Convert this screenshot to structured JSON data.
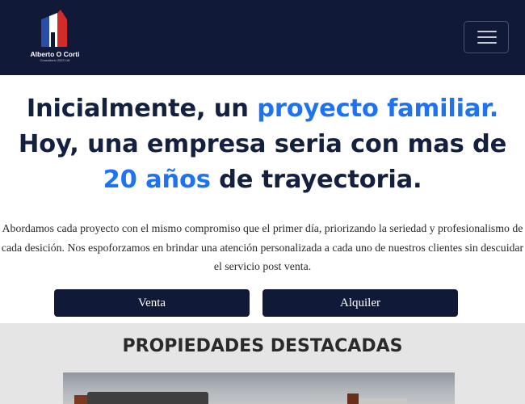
{
  "header": {
    "logo_name": "Alberto O Corti",
    "logo_subtitle": "Consultorio 2023 LW",
    "logo_colors": [
      "#2a4da8",
      "#ffffff",
      "#d52a2a"
    ],
    "menu_icon": "hamburger-icon",
    "background": "#111938"
  },
  "hero": {
    "line1_a": "Inicialmente, un ",
    "line1_highlight": "proyecto familiar.",
    "line2": "Hoy, una empresa seria con mas de",
    "line3_highlight": "20 años",
    "line3_b": " de trayectoria.",
    "text_color": "#13203f",
    "highlight_color": "#1f72f0"
  },
  "intro": {
    "paragraph": "Abordamos cada proyecto con el mismo compromiso que el primer día, priorizando la seriedad y profesionalismo de cada desición. Nos espoforzamos en brindar una atención personalizada a cada uno de nuestros clientes sin descuidar el servicio post venta."
  },
  "actions": {
    "venta_label": "Venta",
    "alquiler_label": "Alquiler"
  },
  "featured": {
    "title": "PROPIEDADES DESTACADAS"
  }
}
